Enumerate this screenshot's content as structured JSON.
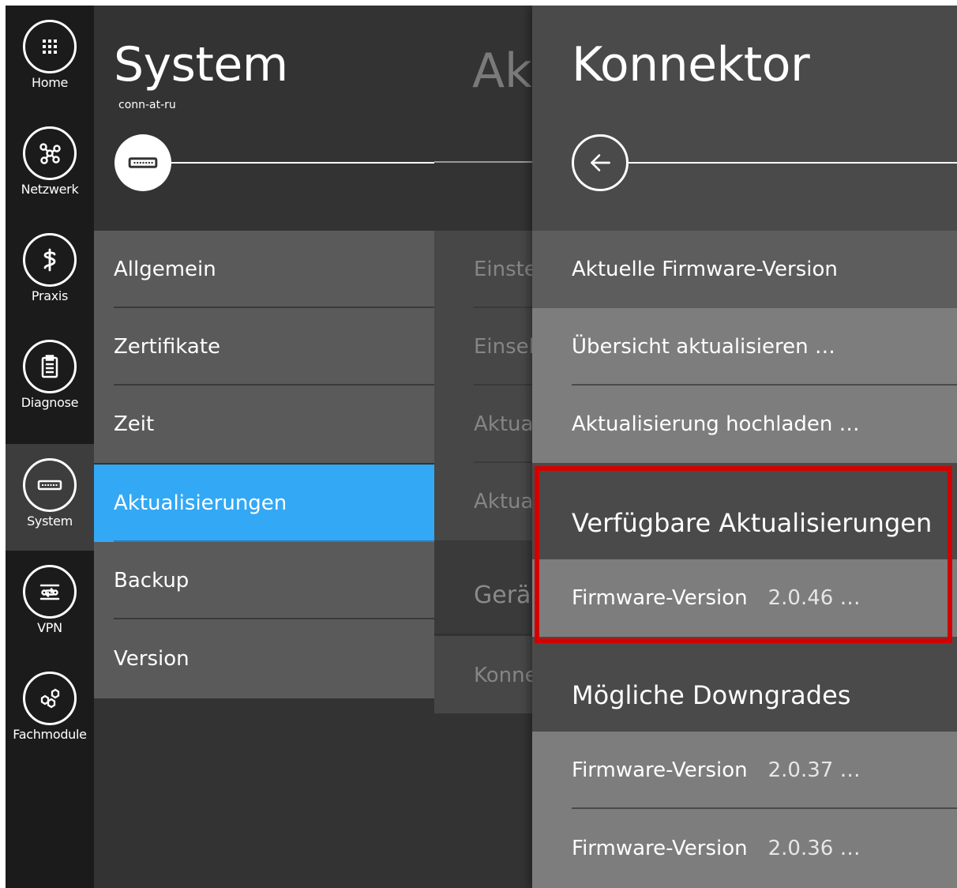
{
  "nav": {
    "items": [
      {
        "label": "Home",
        "icon": "grid-icon"
      },
      {
        "label": "Netzwerk",
        "icon": "network-icon"
      },
      {
        "label": "Praxis",
        "icon": "medical-icon"
      },
      {
        "label": "Diagnose",
        "icon": "clipboard-icon"
      },
      {
        "label": "System",
        "icon": "device-icon",
        "active": true
      },
      {
        "label": "VPN",
        "icon": "vpn-icon"
      },
      {
        "label": "Fachmodule",
        "icon": "hexagons-icon"
      }
    ]
  },
  "system": {
    "title": "System",
    "subtitle": "conn-at-ru",
    "items": [
      {
        "label": "Allgemein"
      },
      {
        "label": "Zertifikate"
      },
      {
        "label": "Zeit"
      },
      {
        "label": "Aktualisierungen",
        "active": true
      },
      {
        "label": "Backup"
      },
      {
        "label": "Version"
      }
    ]
  },
  "middle": {
    "title": "Ak",
    "rows": [
      "Einste",
      "Einsel",
      "Aktua",
      "Aktua"
    ],
    "section": "Gerä",
    "section_row": "Konne"
  },
  "konnektor": {
    "title": "Konnektor",
    "top_rows": [
      {
        "label": "Aktuelle Firmware-Version"
      },
      {
        "label": "Übersicht aktualisieren …"
      },
      {
        "label": "Aktualisierung hochladen …"
      }
    ],
    "available": {
      "heading": "Verfügbare Aktualisierungen",
      "items": [
        {
          "label": "Firmware-Version",
          "version": "2.0.46 …"
        }
      ]
    },
    "downgrades": {
      "heading": "Mögliche Downgrades",
      "items": [
        {
          "label": "Firmware-Version",
          "version": "2.0.37 …"
        },
        {
          "label": "Firmware-Version",
          "version": "2.0.36 …"
        }
      ]
    }
  },
  "colors": {
    "accent": "#33a8f5",
    "highlight": "#d30000",
    "rail": "#1b1b1b"
  }
}
